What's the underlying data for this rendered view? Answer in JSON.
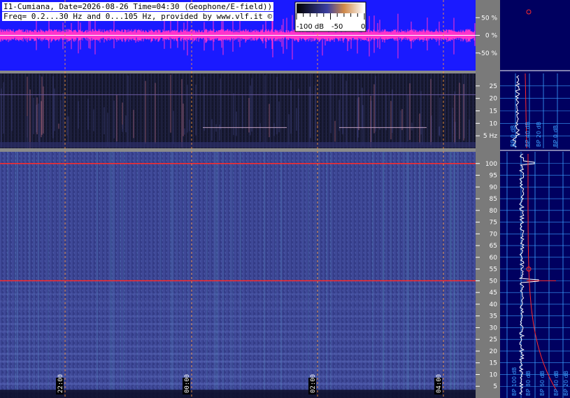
{
  "header": {
    "line1": "I1-Cumiana, Date=2026-08-26 Time=04:30 (Geophone/E-field))",
    "line2": "Freq= 0.2...30 Hz and 0...105 Hz, provided by www.vlf.it ©"
  },
  "colorbar": {
    "labels": [
      "-100 dB",
      "-50",
      "0"
    ]
  },
  "colors": {
    "waveform": "#ff33cc",
    "waveform_bg": "#1a1aff",
    "marker_red": "#ff2a2a",
    "grid_cyan": "#3aa0ff",
    "cursor_orange": "#ff9a3c"
  },
  "chart_data": [
    {
      "type": "area",
      "name": "waveform",
      "ylabel": "",
      "ylim": [
        -100,
        100
      ],
      "y_ticks": [
        "50 %",
        "0 %",
        "-50 %"
      ],
      "y_tick_values": [
        50,
        0,
        -50
      ]
    },
    {
      "type": "heatmap",
      "name": "spectrogram-low",
      "ylim": [
        0,
        30
      ],
      "y_ticks": [
        "25",
        "20",
        "15",
        "10",
        "5 Hz"
      ],
      "y_tick_values": [
        25,
        20,
        15,
        10,
        5
      ]
    },
    {
      "type": "heatmap",
      "name": "spectrogram-high",
      "ylim": [
        0,
        105
      ],
      "y_ticks": [
        "100",
        "95",
        "90",
        "85",
        "80",
        "75",
        "70",
        "65",
        "60",
        "55",
        "50",
        "45",
        "40",
        "35",
        "30",
        "25",
        "20",
        "15",
        "10",
        "5"
      ],
      "y_tick_values": [
        100,
        95,
        90,
        85,
        80,
        75,
        70,
        65,
        60,
        55,
        50,
        45,
        40,
        35,
        30,
        25,
        20,
        15,
        10,
        5
      ],
      "x_ticks": [
        "22:00",
        "00:00",
        "02:00",
        "04:00"
      ],
      "marked_lines_hz": [
        50,
        100
      ]
    },
    {
      "type": "line",
      "name": "spectrum-profile-low",
      "x_ticks": [
        "BP 0 dB",
        "BP 40 dB",
        "BP 20 dB",
        "BP 0 dB"
      ]
    },
    {
      "type": "line",
      "name": "spectrum-profile-high",
      "x_ticks": [
        "BP 100 dB",
        "BP 80 dB",
        "BP 60 dB",
        "BP 40 dB",
        "BP 20 dB",
        "BP 0 dB"
      ]
    }
  ]
}
